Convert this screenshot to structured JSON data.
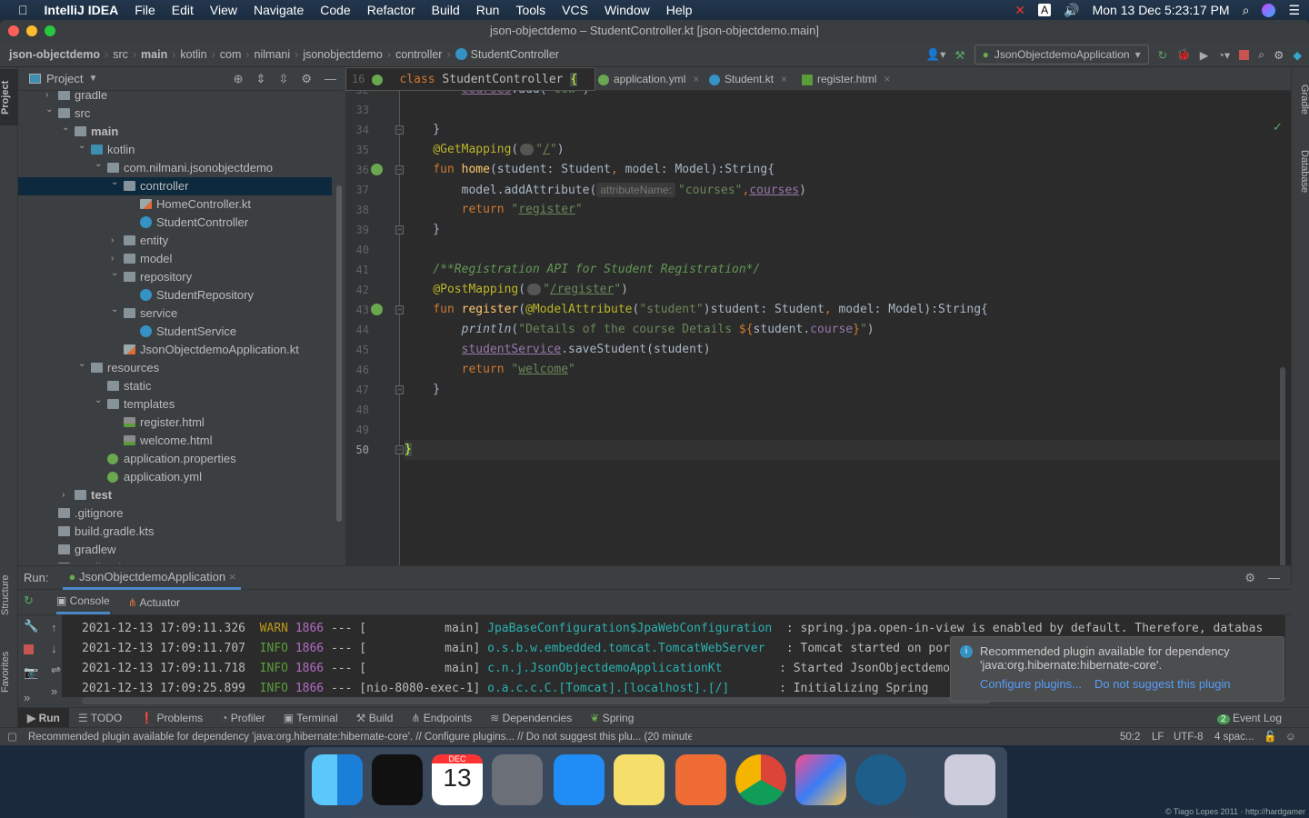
{
  "menubar": {
    "app": "IntelliJ IDEA",
    "items": [
      "File",
      "Edit",
      "View",
      "Navigate",
      "Code",
      "Refactor",
      "Build",
      "Run",
      "Tools",
      "VCS",
      "Window",
      "Help"
    ],
    "clock": "Mon 13 Dec  5:23:17 PM",
    "input_source": "A"
  },
  "window": {
    "title": "json-objectdemo – StudentController.kt [json-objectdemo.main]"
  },
  "breadcrumb": [
    "json-objectdemo",
    "src",
    "main",
    "kotlin",
    "com",
    "nilmani",
    "jsonobjectdemo",
    "controller",
    "StudentController"
  ],
  "toolbar": {
    "run_config": "JsonObjectdemoApplication"
  },
  "left_strip": {
    "project": "Project",
    "structure": "Structure",
    "favorites": "Favorites"
  },
  "right_strip": {
    "gradle": "Gradle",
    "database": "Database"
  },
  "project_panel": {
    "title": "Project"
  },
  "tree": [
    {
      "label": "gradle",
      "depth": 0,
      "type": "folder",
      "arrow": "collapsed"
    },
    {
      "label": "src",
      "depth": 0,
      "type": "folder",
      "arrow": "expanded"
    },
    {
      "label": "main",
      "depth": 1,
      "type": "folder",
      "arrow": "expanded",
      "bold": true
    },
    {
      "label": "kotlin",
      "depth": 2,
      "type": "src",
      "arrow": "expanded"
    },
    {
      "label": "com.nilmani.jsonobjectdemo",
      "depth": 3,
      "type": "folder",
      "arrow": "expanded"
    },
    {
      "label": "controller",
      "depth": 4,
      "type": "folder",
      "arrow": "expanded",
      "selected": true
    },
    {
      "label": "HomeController.kt",
      "depth": 5,
      "type": "kt"
    },
    {
      "label": "StudentController",
      "depth": 5,
      "type": "cls"
    },
    {
      "label": "entity",
      "depth": 4,
      "type": "folder",
      "arrow": "collapsed"
    },
    {
      "label": "model",
      "depth": 4,
      "type": "folder",
      "arrow": "collapsed"
    },
    {
      "label": "repository",
      "depth": 4,
      "type": "folder",
      "arrow": "expanded"
    },
    {
      "label": "StudentRepository",
      "depth": 5,
      "type": "cls"
    },
    {
      "label": "service",
      "depth": 4,
      "type": "folder",
      "arrow": "expanded"
    },
    {
      "label": "StudentService",
      "depth": 5,
      "type": "cls"
    },
    {
      "label": "JsonObjectdemoApplication.kt",
      "depth": 4,
      "type": "kt"
    },
    {
      "label": "resources",
      "depth": 2,
      "type": "folder",
      "arrow": "expanded"
    },
    {
      "label": "static",
      "depth": 3,
      "type": "folder"
    },
    {
      "label": "templates",
      "depth": 3,
      "type": "folder",
      "arrow": "expanded"
    },
    {
      "label": "register.html",
      "depth": 4,
      "type": "html"
    },
    {
      "label": "welcome.html",
      "depth": 4,
      "type": "html"
    },
    {
      "label": "application.properties",
      "depth": 3,
      "type": "spring"
    },
    {
      "label": "application.yml",
      "depth": 3,
      "type": "spring"
    },
    {
      "label": "test",
      "depth": 1,
      "type": "folder",
      "arrow": "collapsed",
      "bold": true
    },
    {
      "label": ".gitignore",
      "depth": 0,
      "type": "txtfile"
    },
    {
      "label": "build.gradle.kts",
      "depth": 0,
      "type": "txtfile"
    },
    {
      "label": "gradlew",
      "depth": 0,
      "type": "txtfile"
    },
    {
      "label": "gradlew.bat",
      "depth": 0,
      "type": "txtfile"
    }
  ],
  "editor": {
    "tabs": [
      {
        "label": "application.yml"
      },
      {
        "label": "Student.kt"
      },
      {
        "label": "register.html"
      }
    ],
    "sticky_line": {
      "number": "16",
      "tokens": [
        [
          "class ",
          "k"
        ],
        [
          "StudentController ",
          ""
        ],
        [
          "{",
          "cur"
        ]
      ]
    },
    "lines": [
      {
        "n": "32",
        "tokens": [
          [
            "        ",
            ""
          ],
          [
            "courses",
            "p u"
          ],
          [
            ".add(",
            ""
          ],
          [
            "\"cow\"",
            "s"
          ],
          [
            ")",
            ""
          ]
        ]
      },
      {
        "n": "33",
        "tokens": []
      },
      {
        "n": "34",
        "tokens": [
          [
            "    }",
            ""
          ]
        ]
      },
      {
        "n": "35",
        "tokens": [
          [
            "    ",
            ""
          ],
          [
            "@GetMapping",
            "a"
          ],
          [
            "(",
            ""
          ],
          [
            "◎⌄",
            "gi"
          ],
          [
            "\"",
            "s"
          ],
          [
            "/",
            "s u"
          ],
          [
            "\"",
            "s"
          ],
          [
            ")",
            ""
          ]
        ]
      },
      {
        "n": "36",
        "tokens": [
          [
            "    ",
            ""
          ],
          [
            "fun ",
            "k"
          ],
          [
            "home",
            "f"
          ],
          [
            "(student: Student",
            ""
          ],
          [
            ", ",
            "k"
          ],
          [
            "model: Model):String{",
            ""
          ]
        ]
      },
      {
        "n": "37",
        "tokens": [
          [
            "        model.addAttribute(",
            ""
          ],
          [
            "attributeName:",
            "h"
          ],
          [
            "\"courses\"",
            "s"
          ],
          [
            ",",
            "k"
          ],
          [
            "courses",
            "p u"
          ],
          [
            ")",
            ""
          ]
        ]
      },
      {
        "n": "38",
        "tokens": [
          [
            "        ",
            ""
          ],
          [
            "return ",
            "k"
          ],
          [
            "\"",
            "s"
          ],
          [
            "register",
            "s u"
          ],
          [
            "\"",
            "s"
          ]
        ]
      },
      {
        "n": "39",
        "tokens": [
          [
            "    }",
            ""
          ]
        ]
      },
      {
        "n": "40",
        "tokens": []
      },
      {
        "n": "41",
        "tokens": [
          [
            "    ",
            ""
          ],
          [
            "/**Registration API for Student Registration*/",
            "c"
          ]
        ]
      },
      {
        "n": "42",
        "tokens": [
          [
            "    ",
            ""
          ],
          [
            "@PostMapping",
            "a"
          ],
          [
            "(",
            ""
          ],
          [
            "◎⌄",
            "gi"
          ],
          [
            "\"",
            "s"
          ],
          [
            "/register",
            "s u"
          ],
          [
            "\"",
            "s"
          ],
          [
            ")",
            ""
          ]
        ]
      },
      {
        "n": "43",
        "tokens": [
          [
            "    ",
            ""
          ],
          [
            "fun ",
            "k"
          ],
          [
            "register",
            "f"
          ],
          [
            "(",
            ""
          ],
          [
            "@ModelAttribute",
            "a"
          ],
          [
            "(",
            ""
          ],
          [
            "\"student\"",
            "s"
          ],
          [
            ")student: Student",
            ""
          ],
          [
            ", ",
            "k"
          ],
          [
            "model: Model):String{",
            ""
          ]
        ]
      },
      {
        "n": "44",
        "tokens": [
          [
            "        ",
            ""
          ],
          [
            "println",
            "i"
          ],
          [
            "(",
            ""
          ],
          [
            "\"Details of the course Details ",
            "s"
          ],
          [
            "${",
            "k"
          ],
          [
            "student.",
            ""
          ],
          [
            "course",
            "p"
          ],
          [
            "}",
            "k"
          ],
          [
            "\"",
            "s"
          ],
          [
            ")",
            ""
          ]
        ]
      },
      {
        "n": "45",
        "tokens": [
          [
            "        ",
            ""
          ],
          [
            "studentService",
            "p u"
          ],
          [
            ".saveStudent(student)",
            ""
          ]
        ]
      },
      {
        "n": "46",
        "tokens": [
          [
            "        ",
            ""
          ],
          [
            "return ",
            "k"
          ],
          [
            "\"",
            "s"
          ],
          [
            "welcome",
            "s u"
          ],
          [
            "\"",
            "s"
          ]
        ]
      },
      {
        "n": "47",
        "tokens": [
          [
            "    }",
            ""
          ]
        ]
      },
      {
        "n": "48",
        "tokens": []
      },
      {
        "n": "49",
        "tokens": []
      },
      {
        "n": "50",
        "tokens": [
          [
            "}",
            "cur"
          ]
        ]
      }
    ]
  },
  "run_panel": {
    "label": "Run:",
    "tab": "JsonObjectdemoApplication",
    "subtabs": [
      "Console",
      "Actuator"
    ],
    "log": [
      {
        "ts": "2021-12-13 17:09:11.326",
        "level": "WARN",
        "pid": "1866",
        "sep": "---",
        "thread": "[           main]",
        "logger": "JpaBaseConfiguration$JpaWebConfiguration",
        "msg": ": spring.jpa.open-in-view is enabled by default. Therefore, databas"
      },
      {
        "ts": "2021-12-13 17:09:11.707",
        "level": "INFO",
        "pid": "1866",
        "sep": "---",
        "thread": "[           main]",
        "logger": "o.s.b.w.embedded.tomcat.TomcatWebServer ",
        "msg": ": Tomcat started on port"
      },
      {
        "ts": "2021-12-13 17:09:11.718",
        "level": "INFO",
        "pid": "1866",
        "sep": "---",
        "thread": "[           main]",
        "logger": "c.n.j.JsonObjectdemoApplicationKt      ",
        "msg": ": Started JsonObjectdemo"
      },
      {
        "ts": "2021-12-13 17:09:25.899",
        "level": "INFO",
        "pid": "1866",
        "sep": "---",
        "thread": "[nio-8080-exec-1]",
        "logger": "o.a.c.c.C.[Tomcat].[localhost].[/]     ",
        "msg": ": Initializing Spring"
      }
    ]
  },
  "notification": {
    "text1": "Recommended plugin available for dependency",
    "text2": "'java:org.hibernate:hibernate-core'.",
    "action1": "Configure plugins...",
    "action2": "Do not suggest this plugin"
  },
  "bottom_tabs": [
    "Run",
    "TODO",
    "Problems",
    "Profiler",
    "Terminal",
    "Build",
    "Endpoints",
    "Dependencies",
    "Spring"
  ],
  "event_log": {
    "count": "2",
    "label": "Event Log"
  },
  "status": {
    "message": "Recommended plugin available for dependency 'java:org.hibernate:hibernate-core'. // Configure plugins... // Do not suggest this plu... (20 minutes ago)",
    "position": "50:2",
    "line_sep": "LF",
    "encoding": "UTF-8",
    "indent": "4 spac..."
  },
  "dock": {
    "items": [
      "Finder",
      "Terminal",
      "Calendar",
      "Launchpad",
      "Instruments",
      "Notes",
      "Postman",
      "Chrome",
      "IntelliJ IDEA",
      "MySQL Workbench",
      "Trash"
    ],
    "calendar_month": "DEC",
    "calendar_day": "13"
  },
  "watermark": "© Tiago Lopes 2011 · http://hardgamer"
}
